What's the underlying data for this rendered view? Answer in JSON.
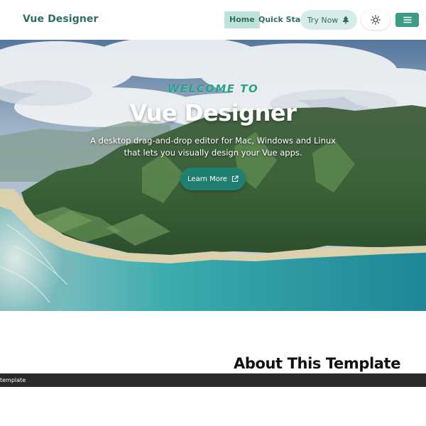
{
  "nav": {
    "brand": "Vue Designer",
    "links": [
      {
        "label": "Home",
        "active": true
      },
      {
        "label": "Quick Start",
        "active": false
      }
    ],
    "try_now_label": "Try Now",
    "try_now_icon": "tree-icon",
    "theme_icon": "sun-icon",
    "menu_icon": "hamburger-menu-icon"
  },
  "hero": {
    "welcome": "WELCOME TO",
    "title": "Vue Designer",
    "subtitle": "A desktop drag-and-drop editor for Mac, Windows and Linux that lets you visually design your Vue apps.",
    "cta_label": "Learn More",
    "cta_icon": "external-link-icon",
    "background": "aerial-coastline-mountains-image"
  },
  "about": {
    "title": "About This Template"
  },
  "status_bar": {
    "text": "template"
  },
  "colors": {
    "brand": "#2e6f64",
    "accent": "#3c9c88",
    "welcome": "#28a38a",
    "cta": "#1f7f70",
    "status_bar": "#2a2a2a"
  }
}
